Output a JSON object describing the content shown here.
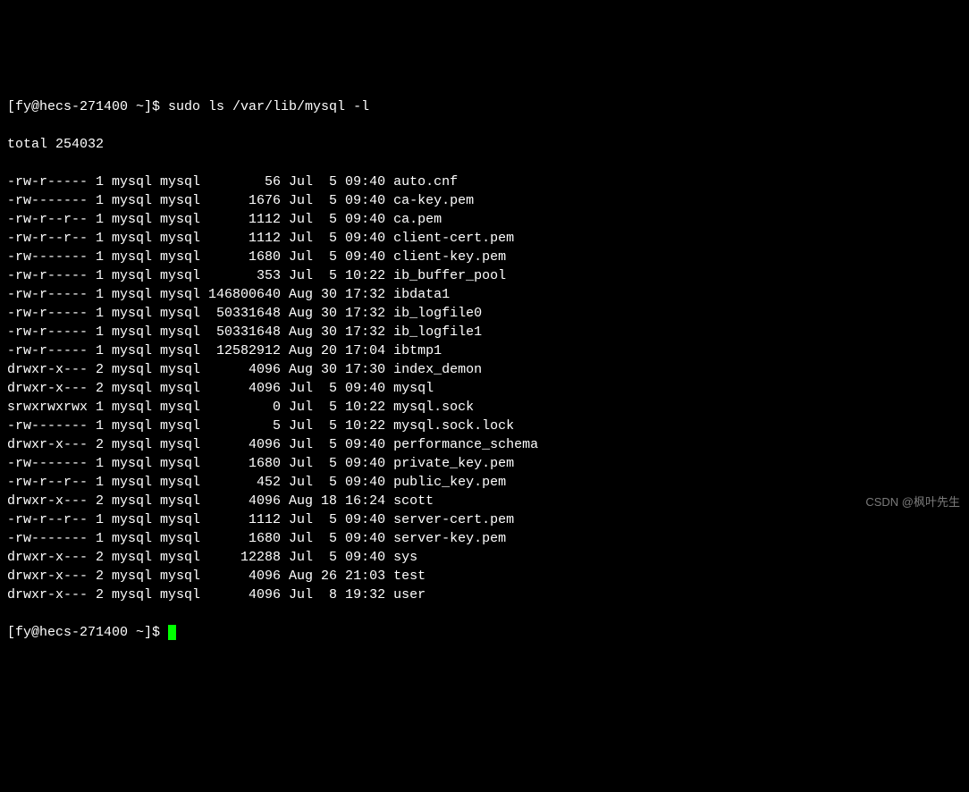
{
  "prompt1_prefix": "[fy@hecs-271400 ~]$ ",
  "command": "sudo ls /var/lib/mysql -l",
  "total_line": "total 254032",
  "listing": [
    {
      "perm": "-rw-r-----",
      "links": "1",
      "owner": "mysql",
      "group": "mysql",
      "size": "56",
      "month": "Jul",
      "day": "5",
      "time": "09:40",
      "name": "auto.cnf"
    },
    {
      "perm": "-rw-------",
      "links": "1",
      "owner": "mysql",
      "group": "mysql",
      "size": "1676",
      "month": "Jul",
      "day": "5",
      "time": "09:40",
      "name": "ca-key.pem"
    },
    {
      "perm": "-rw-r--r--",
      "links": "1",
      "owner": "mysql",
      "group": "mysql",
      "size": "1112",
      "month": "Jul",
      "day": "5",
      "time": "09:40",
      "name": "ca.pem"
    },
    {
      "perm": "-rw-r--r--",
      "links": "1",
      "owner": "mysql",
      "group": "mysql",
      "size": "1112",
      "month": "Jul",
      "day": "5",
      "time": "09:40",
      "name": "client-cert.pem"
    },
    {
      "perm": "-rw-------",
      "links": "1",
      "owner": "mysql",
      "group": "mysql",
      "size": "1680",
      "month": "Jul",
      "day": "5",
      "time": "09:40",
      "name": "client-key.pem"
    },
    {
      "perm": "-rw-r-----",
      "links": "1",
      "owner": "mysql",
      "group": "mysql",
      "size": "353",
      "month": "Jul",
      "day": "5",
      "time": "10:22",
      "name": "ib_buffer_pool"
    },
    {
      "perm": "-rw-r-----",
      "links": "1",
      "owner": "mysql",
      "group": "mysql",
      "size": "146800640",
      "month": "Aug",
      "day": "30",
      "time": "17:32",
      "name": "ibdata1"
    },
    {
      "perm": "-rw-r-----",
      "links": "1",
      "owner": "mysql",
      "group": "mysql",
      "size": "50331648",
      "month": "Aug",
      "day": "30",
      "time": "17:32",
      "name": "ib_logfile0"
    },
    {
      "perm": "-rw-r-----",
      "links": "1",
      "owner": "mysql",
      "group": "mysql",
      "size": "50331648",
      "month": "Aug",
      "day": "30",
      "time": "17:32",
      "name": "ib_logfile1"
    },
    {
      "perm": "-rw-r-----",
      "links": "1",
      "owner": "mysql",
      "group": "mysql",
      "size": "12582912",
      "month": "Aug",
      "day": "20",
      "time": "17:04",
      "name": "ibtmp1"
    },
    {
      "perm": "drwxr-x---",
      "links": "2",
      "owner": "mysql",
      "group": "mysql",
      "size": "4096",
      "month": "Aug",
      "day": "30",
      "time": "17:30",
      "name": "index_demon"
    },
    {
      "perm": "drwxr-x---",
      "links": "2",
      "owner": "mysql",
      "group": "mysql",
      "size": "4096",
      "month": "Jul",
      "day": "5",
      "time": "09:40",
      "name": "mysql"
    },
    {
      "perm": "srwxrwxrwx",
      "links": "1",
      "owner": "mysql",
      "group": "mysql",
      "size": "0",
      "month": "Jul",
      "day": "5",
      "time": "10:22",
      "name": "mysql.sock"
    },
    {
      "perm": "-rw-------",
      "links": "1",
      "owner": "mysql",
      "group": "mysql",
      "size": "5",
      "month": "Jul",
      "day": "5",
      "time": "10:22",
      "name": "mysql.sock.lock"
    },
    {
      "perm": "drwxr-x---",
      "links": "2",
      "owner": "mysql",
      "group": "mysql",
      "size": "4096",
      "month": "Jul",
      "day": "5",
      "time": "09:40",
      "name": "performance_schema"
    },
    {
      "perm": "-rw-------",
      "links": "1",
      "owner": "mysql",
      "group": "mysql",
      "size": "1680",
      "month": "Jul",
      "day": "5",
      "time": "09:40",
      "name": "private_key.pem"
    },
    {
      "perm": "-rw-r--r--",
      "links": "1",
      "owner": "mysql",
      "group": "mysql",
      "size": "452",
      "month": "Jul",
      "day": "5",
      "time": "09:40",
      "name": "public_key.pem"
    },
    {
      "perm": "drwxr-x---",
      "links": "2",
      "owner": "mysql",
      "group": "mysql",
      "size": "4096",
      "month": "Aug",
      "day": "18",
      "time": "16:24",
      "name": "scott"
    },
    {
      "perm": "-rw-r--r--",
      "links": "1",
      "owner": "mysql",
      "group": "mysql",
      "size": "1112",
      "month": "Jul",
      "day": "5",
      "time": "09:40",
      "name": "server-cert.pem"
    },
    {
      "perm": "-rw-------",
      "links": "1",
      "owner": "mysql",
      "group": "mysql",
      "size": "1680",
      "month": "Jul",
      "day": "5",
      "time": "09:40",
      "name": "server-key.pem"
    },
    {
      "perm": "drwxr-x---",
      "links": "2",
      "owner": "mysql",
      "group": "mysql",
      "size": "12288",
      "month": "Jul",
      "day": "5",
      "time": "09:40",
      "name": "sys"
    },
    {
      "perm": "drwxr-x---",
      "links": "2",
      "owner": "mysql",
      "group": "mysql",
      "size": "4096",
      "month": "Aug",
      "day": "26",
      "time": "21:03",
      "name": "test"
    },
    {
      "perm": "drwxr-x---",
      "links": "2",
      "owner": "mysql",
      "group": "mysql",
      "size": "4096",
      "month": "Jul",
      "day": "8",
      "time": "19:32",
      "name": "user"
    }
  ],
  "prompt2_prefix": "[fy@hecs-271400 ~]$ ",
  "watermark": "CSDN @枫叶先生"
}
